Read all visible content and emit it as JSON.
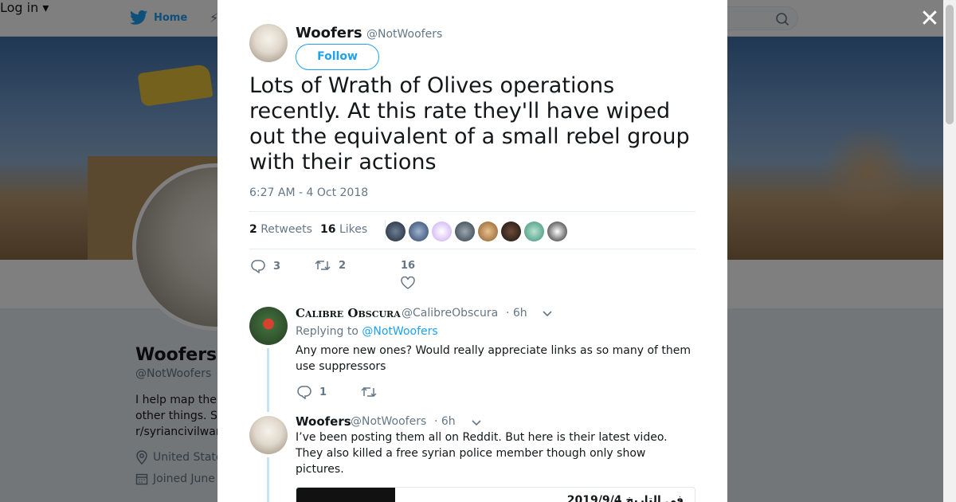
{
  "topbar": {
    "home_label": "Home",
    "login_label": "Log in ▾"
  },
  "profile": {
    "name": "Woofers",
    "handle": "@NotWoofers",
    "bio": "I help map the\nother things. S\nr/syriancivilwar",
    "location": "United State",
    "joined": "Joined June"
  },
  "modal": {
    "close_label": "✕",
    "tweet": {
      "author_name": "Woofers",
      "author_handle": "@NotWoofers",
      "follow_label": "Follow",
      "text": "Lots of Wrath of Olives operations recently. At this rate they'll have wiped out the equivalent of a small rebel group with their actions",
      "timestamp": "6:27 AM - 4 Oct 2018",
      "retweets_count": "2",
      "retweets_label": "Retweets",
      "likes_count": "16",
      "likes_label": "Likes",
      "reply_count": "3",
      "retweet_action_count": "2",
      "like_action_count": "16"
    },
    "replies": [
      {
        "author_name": "Calibre Obscura",
        "author_handle": "@CalibreObscura",
        "time": "· 6h",
        "replying_prefix": "Replying to",
        "replying_to": "@NotWoofers",
        "text": "Any more new ones? Would really appreciate links as so many of them use suppressors",
        "reply_count": "1"
      },
      {
        "author_name": "Woofers",
        "author_handle": "@NotWoofers",
        "time": "· 6h",
        "text": "I’ve been posting them all on Reddit. But here is their latest video. They also killed a free syrian police member though only show pictures.",
        "media_caption": "2019/9/4 في التاريخ"
      }
    ]
  },
  "colors": {
    "accent": "#1da1f2",
    "secondary_text": "#657786",
    "thread_line": "#c4e3f7"
  }
}
